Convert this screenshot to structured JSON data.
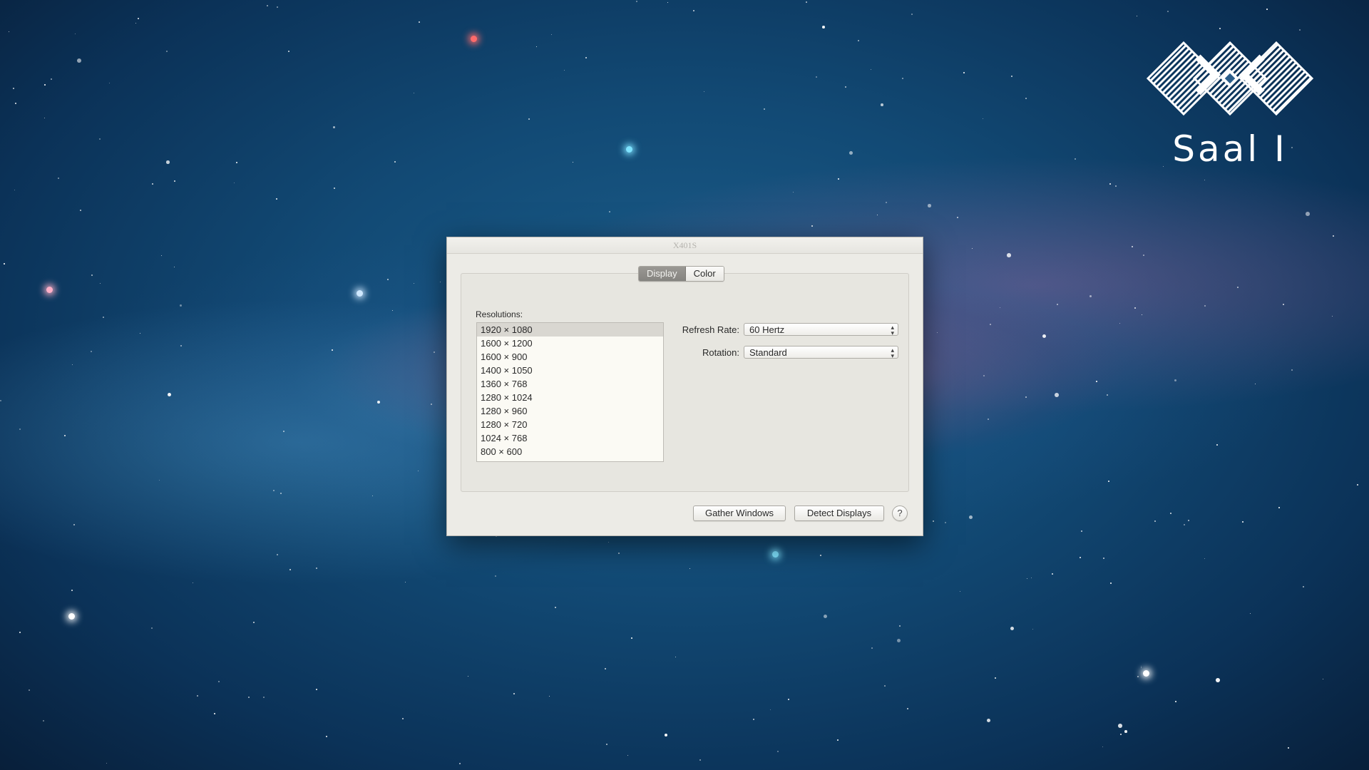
{
  "desktop": {
    "logo_text": "Saal I"
  },
  "dialog": {
    "title": "X401S",
    "tabs": [
      {
        "label": "Display",
        "active": true
      },
      {
        "label": "Color",
        "active": false
      }
    ],
    "resolutions_label": "Resolutions:",
    "resolutions": [
      {
        "label": "1920 × 1080",
        "selected": true
      },
      {
        "label": "1600 × 1200",
        "selected": false
      },
      {
        "label": "1600 × 900",
        "selected": false
      },
      {
        "label": "1400 × 1050",
        "selected": false
      },
      {
        "label": "1360 × 768",
        "selected": false
      },
      {
        "label": "1280 × 1024",
        "selected": false
      },
      {
        "label": "1280 × 960",
        "selected": false
      },
      {
        "label": "1280 × 720",
        "selected": false
      },
      {
        "label": "1024 × 768",
        "selected": false
      },
      {
        "label": "800 × 600",
        "selected": false
      }
    ],
    "refresh_rate_label": "Refresh Rate:",
    "refresh_rate_value": "60 Hertz",
    "rotation_label": "Rotation:",
    "rotation_value": "Standard",
    "gather_windows_label": "Gather Windows",
    "detect_displays_label": "Detect Displays",
    "help_label": "?"
  },
  "icons": {
    "logo": "diamond-chain-logo-icon",
    "select_arrows": "updown-chevron-icon"
  }
}
